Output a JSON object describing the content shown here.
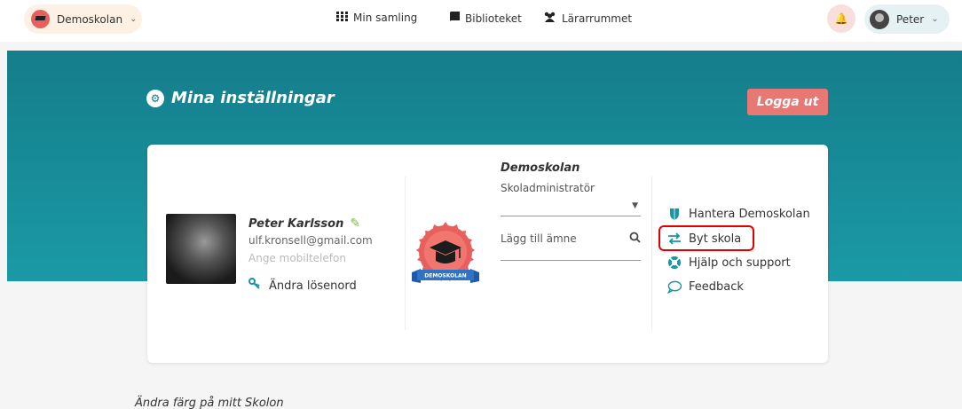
{
  "topbar": {
    "school_selector": "Demoskolan",
    "nav": [
      {
        "label": "Min samling",
        "icon": "grid-icon"
      },
      {
        "label": "Biblioteket",
        "icon": "book-icon"
      },
      {
        "label": "Lärarrummet",
        "icon": "users-icon"
      }
    ],
    "user": "Peter"
  },
  "page": {
    "title": "Mina inställningar",
    "logout_label": "Logga ut"
  },
  "profile": {
    "name": "Peter Karlsson",
    "email": "ulf.kronsell@gmail.com",
    "phone_placeholder": "Ange mobiltelefon",
    "change_password": "Ändra lösenord"
  },
  "school": {
    "name": "Demoskolan",
    "role": "Skoladministratör",
    "subject_placeholder": "Lägg till ämne",
    "badge_text": "DEMOSKOLAN"
  },
  "links": [
    {
      "label": "Hantera Demoskolan",
      "icon": "shield-icon"
    },
    {
      "label": "Byt skola",
      "icon": "swap-icon"
    },
    {
      "label": "Hjälp och support",
      "icon": "lifebuoy-icon"
    },
    {
      "label": "Feedback",
      "icon": "speech-bubble-icon"
    }
  ],
  "bottom": {
    "heading": "Ändra färg på mitt Skolon"
  },
  "colors": {
    "teal": "#157d8b",
    "logout": "#e77874",
    "highlight": "#e00000",
    "badge": "#e8605e"
  }
}
